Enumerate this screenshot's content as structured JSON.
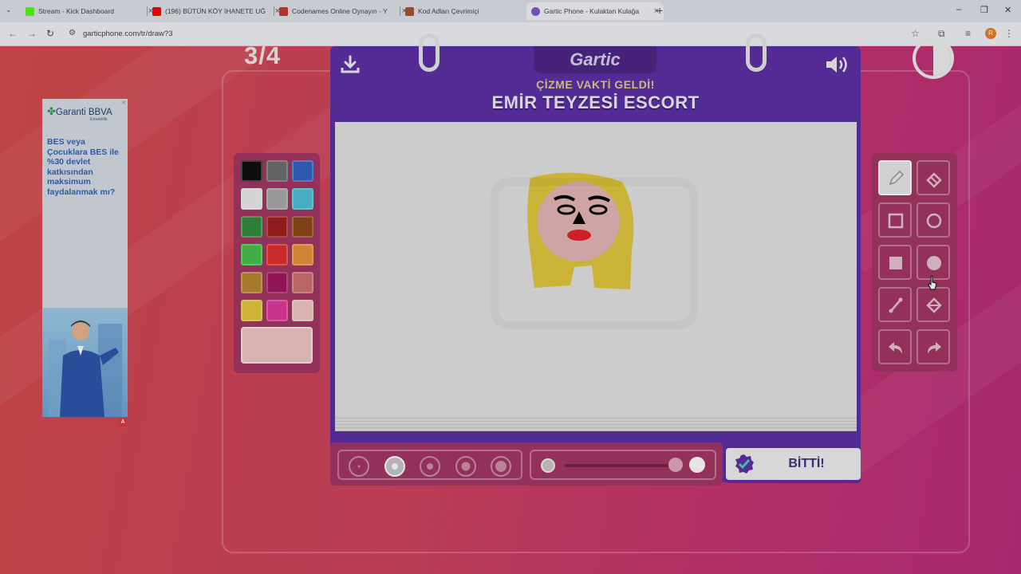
{
  "browser": {
    "tabs": [
      {
        "title": "Stream - Kick Dashboard",
        "favicon_color": "#53fc18",
        "active": false
      },
      {
        "title": "(196) BÜTÜN KÖY İHANETE UĞ",
        "favicon_color": "#ff0000",
        "active": false
      },
      {
        "title": "Codenames Online Oynayın - Y",
        "favicon_color": "#c0392b",
        "active": false
      },
      {
        "title": "Kod Adları Çevrimiçi",
        "favicon_color": "#a0522d",
        "active": false
      },
      {
        "title": "Gartic Phone - Kulaktan Kulağa",
        "favicon_color": "#7e57c2",
        "active": true
      }
    ],
    "url": "garticphone.com/tr/draw?3",
    "profile_initial": "R"
  },
  "game": {
    "step": "3/4",
    "logo": "Gartic",
    "prompt_title": "ÇİZME VAKTİ GELDİ!",
    "prompt_text": "EMİR TEYZESİ ESCORT",
    "done_label": "BİTTİ!",
    "colors": [
      "#0a0a0a",
      "#6b6b6b",
      "#2f5fbf",
      "#ececec",
      "#a9a9a9",
      "#4cc0d8",
      "#2e8b3a",
      "#a01818",
      "#8b4513",
      "#45c049",
      "#e02a2a",
      "#e8913a",
      "#b8862e",
      "#a0135a",
      "#cf6f6f",
      "#e5c93c",
      "#e0359a",
      "#f2c7c2"
    ],
    "current_color": "#f2c7c2",
    "tools": [
      "pencil",
      "eraser",
      "rectangle",
      "ellipse",
      "filled-rectangle",
      "filled-ellipse",
      "line",
      "fill-bucket",
      "undo",
      "redo"
    ],
    "selected_tool": "pencil",
    "brush_sizes": [
      1,
      2,
      3,
      4,
      5
    ],
    "selected_brush_size": 2,
    "opacity": 0.9
  },
  "ad": {
    "brand": "Garanti BBVA",
    "brand_sub": "Emeklilik",
    "text": "BES veya Çocuklara BES ile %30 devlet katkısından maksimum faydalanmak mı?"
  }
}
